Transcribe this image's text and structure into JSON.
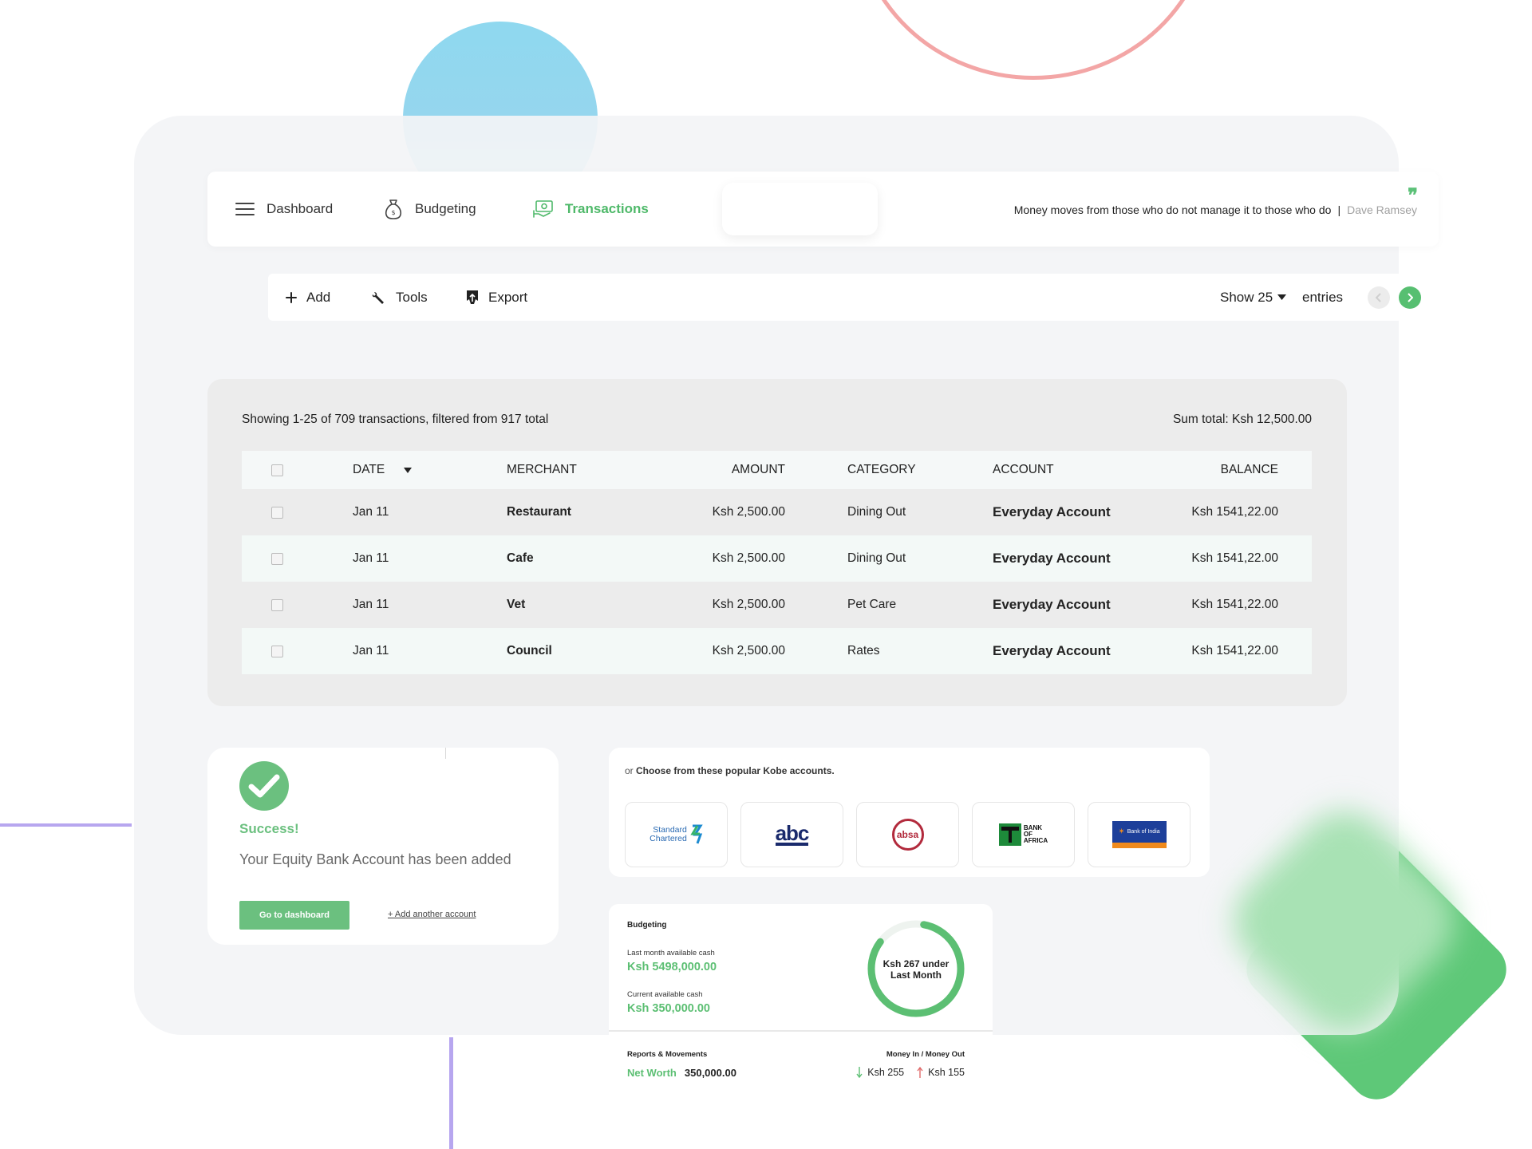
{
  "nav": {
    "items": [
      {
        "label": "Dashboard",
        "icon": "hamburger-icon"
      },
      {
        "label": "Budgeting",
        "icon": "money-bag-icon"
      },
      {
        "label": "Transactions",
        "icon": "transactions-icon",
        "active": true
      }
    ],
    "quote": "Money moves from those who do not manage it to those who do",
    "quote_separator": "|",
    "quote_author": "Dave Ramsey",
    "quote_mark": "❞"
  },
  "toolbar": {
    "add_label": "Add",
    "tools_label": "Tools",
    "export_label": "Export",
    "show_label": "Show 25",
    "entries_label": "entries"
  },
  "table": {
    "showing": "Showing 1-25 of 709 transactions, filtered from 917 total",
    "sum_total": "Sum total: Ksh 12,500.00",
    "columns": {
      "date": "DATE",
      "merchant": "MERCHANT",
      "amount": "AMOUNT",
      "category": "CATEGORY",
      "account": "ACCOUNT",
      "balance": "BALANCE"
    },
    "rows": [
      {
        "date": "Jan 11",
        "merchant": "Restaurant",
        "amount": "Ksh 2,500.00",
        "category": "Dining Out",
        "account": "Everyday Account",
        "balance": "Ksh 1541,22.00"
      },
      {
        "date": "Jan 11",
        "merchant": "Cafe",
        "amount": "Ksh 2,500.00",
        "category": "Dining Out",
        "account": "Everyday Account",
        "balance": "Ksh 1541,22.00"
      },
      {
        "date": "Jan 11",
        "merchant": "Vet",
        "amount": "Ksh 2,500.00",
        "category": "Pet Care",
        "account": "Everyday Account",
        "balance": "Ksh 1541,22.00"
      },
      {
        "date": "Jan 11",
        "merchant": "Council",
        "amount": "Ksh 2,500.00",
        "category": "Rates",
        "account": "Everyday Account",
        "balance": "Ksh 1541,22.00"
      }
    ]
  },
  "success": {
    "title": "Success!",
    "message": "Your Equity Bank Account has been added",
    "primary_button": "Go to dashboard",
    "secondary_link": "+ Add another account"
  },
  "banks": {
    "hint_prefix": "or",
    "hint_bold": "Choose from these popular Kobe accounts.",
    "logos": {
      "standard_chartered_line1": "Standard",
      "standard_chartered_line2": "Chartered",
      "abc": "abc",
      "absa": "absa",
      "boa_line1": "BANK",
      "boa_line2": "OF",
      "boa_line3": "AFRICA",
      "boi": "Bank of India"
    }
  },
  "budget": {
    "title": "Budgeting",
    "last_month_label": "Last month available cash",
    "last_month_value": "Ksh 5498,000.00",
    "current_label": "Current available cash",
    "current_value": "Ksh 350,000.00",
    "ring_text_line1": "Ksh 267 under",
    "ring_text_line2": "Last Month",
    "reports_label": "Reports & Movements",
    "money_in_out_label": "Money In / Money Out",
    "net_worth_label": "Net Worth",
    "net_worth_value": "350,000.00",
    "money_in": "Ksh 255",
    "money_out": "Ksh 155"
  },
  "colors": {
    "accent_green": "#5cbf73",
    "decor_blue": "#8fd8ef",
    "decor_red": "#f3a6a6",
    "decor_purple": "#b7a6ef"
  }
}
